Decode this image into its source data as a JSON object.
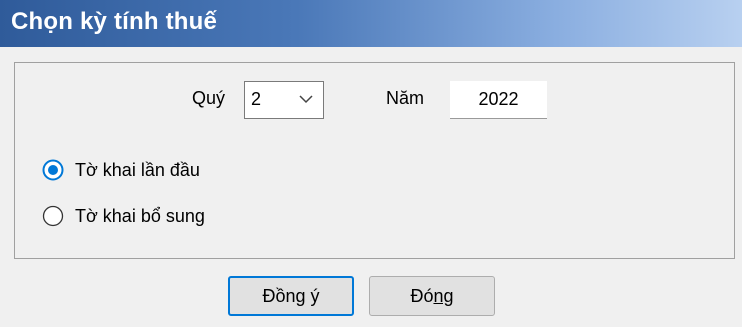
{
  "window": {
    "title": "Chọn kỳ tính thuế"
  },
  "period": {
    "quarter_label": "Quý",
    "quarter_value": "2",
    "year_label": "Năm",
    "year_value": "2022"
  },
  "declaration_type": {
    "options": [
      {
        "label": "Tờ khai lần đầu",
        "selected": true
      },
      {
        "label": "Tờ khai bổ sung",
        "selected": false
      }
    ]
  },
  "buttons": {
    "ok_pre": "Đồn",
    "ok_mnemonic": "g",
    "ok_post": " ý",
    "close_pre": "Đó",
    "close_mnemonic": "ng",
    "close_post": ""
  },
  "colors": {
    "accent": "#0078d7",
    "title_bar": "#2f5b9a"
  }
}
